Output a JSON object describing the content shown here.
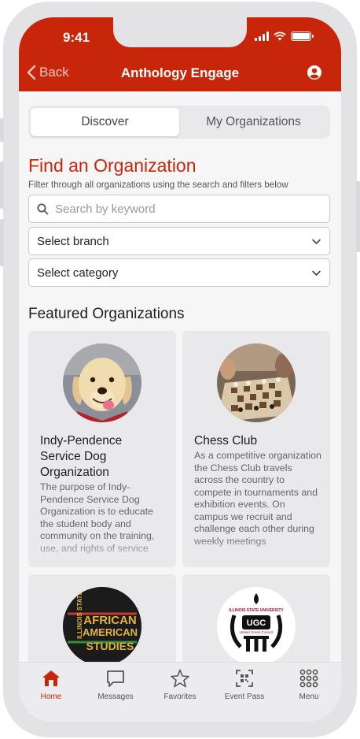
{
  "status": {
    "time": "9:41"
  },
  "nav": {
    "back_label": "Back",
    "title": "Anthology Engage"
  },
  "tabs": [
    {
      "label": "Discover",
      "active": true
    },
    {
      "label": "My Organizations",
      "active": false
    }
  ],
  "find": {
    "title": "Find an Organization",
    "subtitle": "Filter through all organizations using the search and filters below"
  },
  "search": {
    "placeholder": "Search by keyword"
  },
  "filters": {
    "branch": "Select branch",
    "category": "Select category"
  },
  "featured": {
    "title": "Featured Organizations",
    "cards": [
      {
        "name": "Indy-Pendence Service Dog Organization",
        "description": "The purpose of Indy-Pendence Service Dog Organization is to educate the student body and community on the training, use, and rights of service"
      },
      {
        "name": "Chess Club",
        "description": "As a competitive organization the Chess Club travels across the country to compete in tournaments and exhibition events. On campus we recruit and challenge each other during weekly meetings"
      },
      {
        "logo_text": [
          "ILLINOIS STATE",
          "AFRICAN",
          "AMERICAN",
          "STUDIES"
        ]
      },
      {
        "logo_text": [
          "ILLINOIS STATE UNIVERSITY",
          "UGC",
          "United Greek Council"
        ]
      }
    ]
  },
  "tabbar": [
    {
      "label": "Home",
      "icon": "home-icon",
      "active": true
    },
    {
      "label": "Messages",
      "icon": "message-icon",
      "active": false
    },
    {
      "label": "Favorites",
      "icon": "star-icon",
      "active": false
    },
    {
      "label": "Event Pass",
      "icon": "qr-icon",
      "active": false
    },
    {
      "label": "Menu",
      "icon": "grid-icon",
      "active": false
    }
  ],
  "colors": {
    "brand": "#c8260a",
    "card": "#e9e8eb"
  }
}
